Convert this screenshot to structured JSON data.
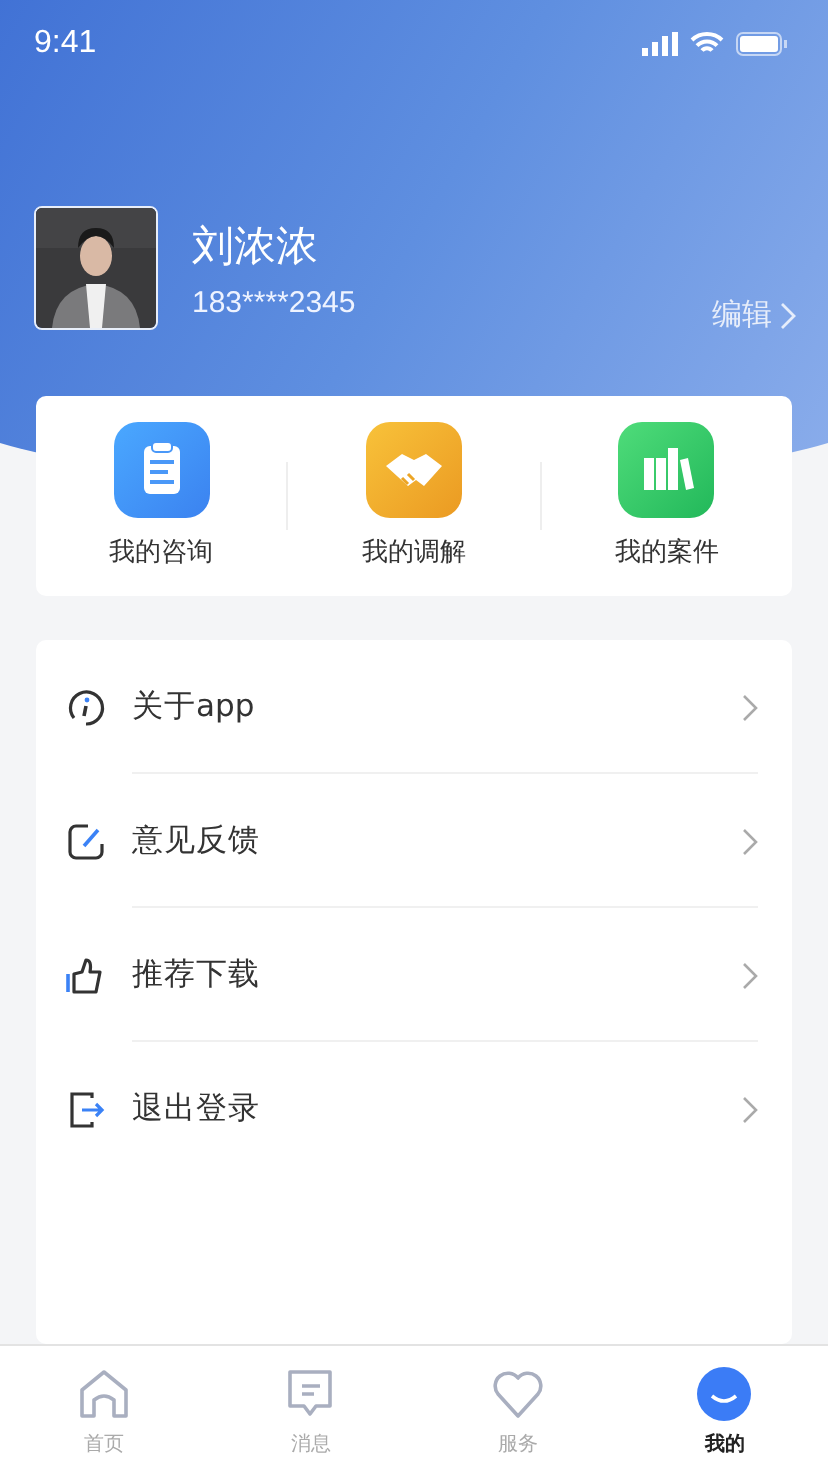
{
  "status_bar": {
    "time": "9:41"
  },
  "profile": {
    "name": "刘浓浓",
    "phone": "183****2345",
    "edit": "编辑"
  },
  "shortcuts": [
    {
      "kind": "consult",
      "label": "我的咨询"
    },
    {
      "kind": "mediation",
      "label": "我的调解"
    },
    {
      "kind": "cases",
      "label": "我的案件"
    }
  ],
  "menu": [
    {
      "kind": "about",
      "label": "关于app"
    },
    {
      "kind": "feedback",
      "label": "意见反馈"
    },
    {
      "kind": "recommend",
      "label": "推荐下载"
    },
    {
      "kind": "logout",
      "label": "退出登录"
    }
  ],
  "tab_bar": [
    {
      "kind": "home",
      "label": "首页",
      "selected": false
    },
    {
      "kind": "messages",
      "label": "消息",
      "selected": false
    },
    {
      "kind": "services",
      "label": "服务",
      "selected": false
    },
    {
      "kind": "me",
      "label": "我的",
      "selected": true
    }
  ]
}
